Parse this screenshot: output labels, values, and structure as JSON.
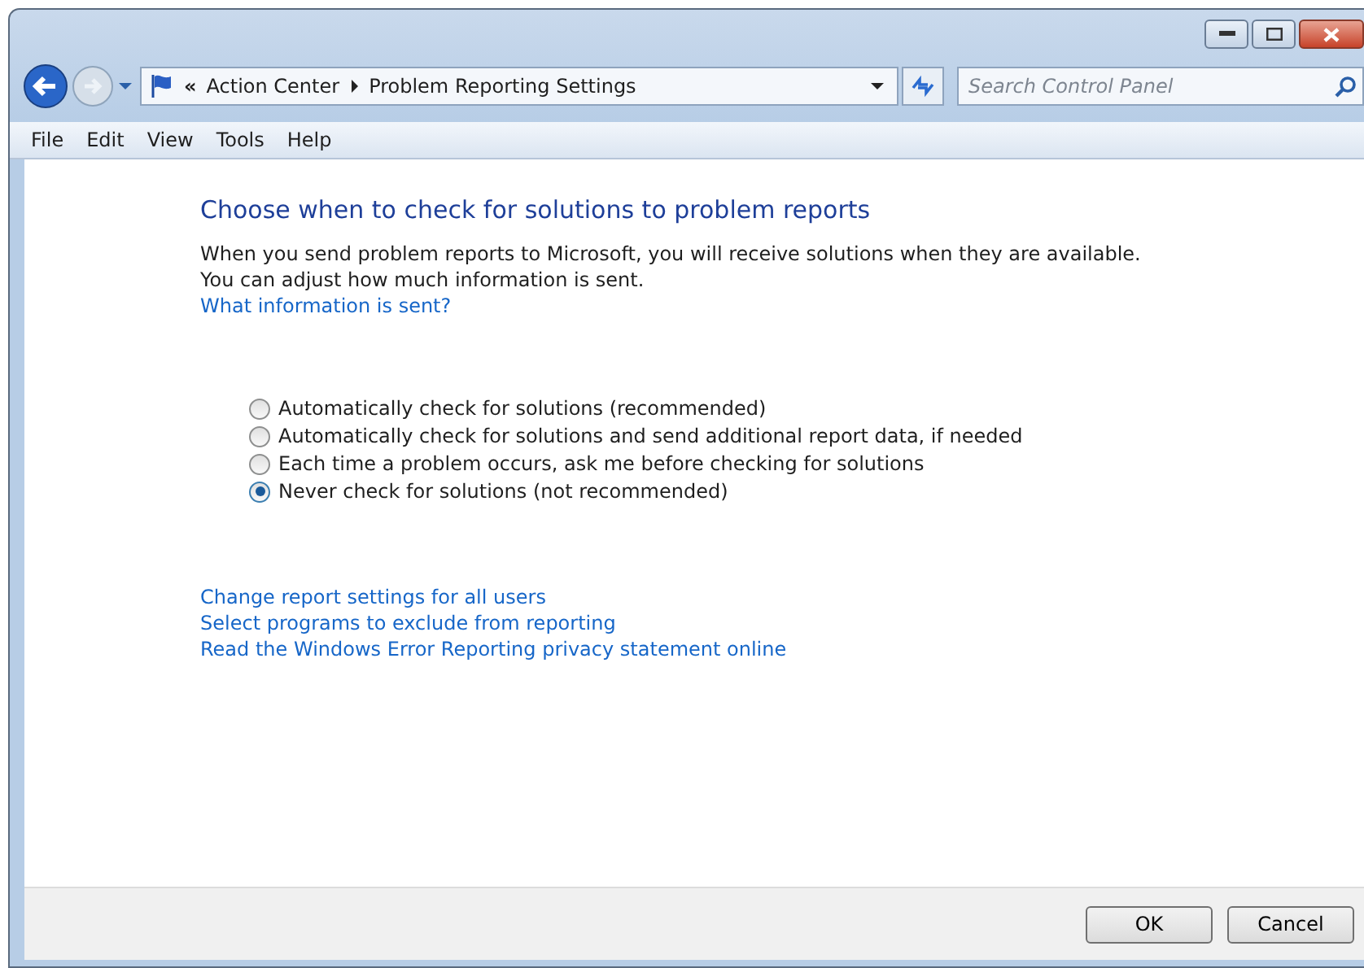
{
  "address_bar": {
    "breadcrumb": [
      {
        "label": "«",
        "kind": "overflow"
      },
      {
        "label": "Action Center",
        "kind": "crumb"
      },
      {
        "label": "Problem Reporting Settings",
        "kind": "crumb"
      }
    ]
  },
  "search": {
    "placeholder": "Search Control Panel"
  },
  "menu": [
    "File",
    "Edit",
    "View",
    "Tools",
    "Help"
  ],
  "content": {
    "heading": "Choose when to check for solutions to problem reports",
    "description": "When you send problem reports to Microsoft, you will receive solutions when they are available. You can adjust how much information is sent.",
    "info_link": "What information is sent?",
    "options": [
      {
        "label": "Automatically check for solutions (recommended)",
        "selected": false
      },
      {
        "label": "Automatically check for solutions and send additional report data, if needed",
        "selected": false
      },
      {
        "label": "Each time a problem occurs, ask me before checking for solutions",
        "selected": false
      },
      {
        "label": "Never check for solutions (not recommended)",
        "selected": true
      }
    ],
    "links": [
      "Change report settings for all users",
      "Select programs to exclude from reporting",
      "Read the Windows Error Reporting privacy statement online"
    ]
  },
  "buttons": [
    "OK",
    "Cancel"
  ]
}
